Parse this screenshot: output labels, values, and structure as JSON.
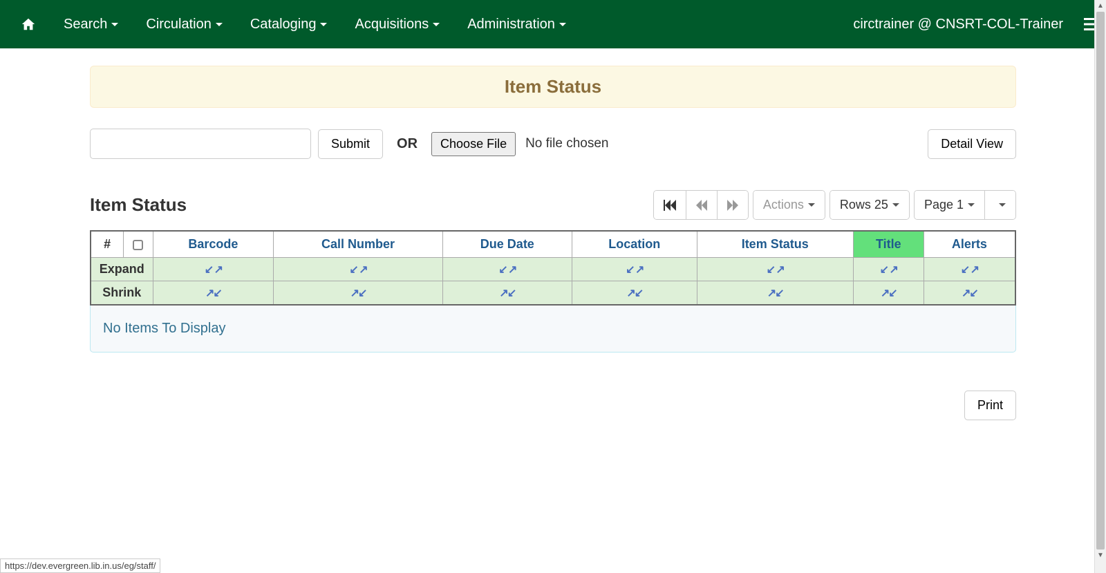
{
  "nav": {
    "items": [
      "Search",
      "Circulation",
      "Cataloging",
      "Acquisitions",
      "Administration"
    ],
    "user": "circtrainer @ CNSRT-COL-Trainer"
  },
  "banner_title": "Item Status",
  "form": {
    "submit": "Submit",
    "or": "OR",
    "choose_file": "Choose File",
    "file_status": "No file chosen",
    "detail_view": "Detail View"
  },
  "section_title": "Item Status",
  "toolbar": {
    "actions": "Actions",
    "rows": "Rows 25",
    "page": "Page 1"
  },
  "columns": {
    "num": "#",
    "c0": "Barcode",
    "c1": "Call Number",
    "c2": "Due Date",
    "c3": "Location",
    "c4": "Item Status",
    "c5": "Title",
    "c6": "Alerts"
  },
  "rowops": {
    "expand": "Expand",
    "shrink": "Shrink"
  },
  "empty": "No Items To Display",
  "print": "Print",
  "status_url": "https://dev.evergreen.lib.in.us/eg/staff/"
}
